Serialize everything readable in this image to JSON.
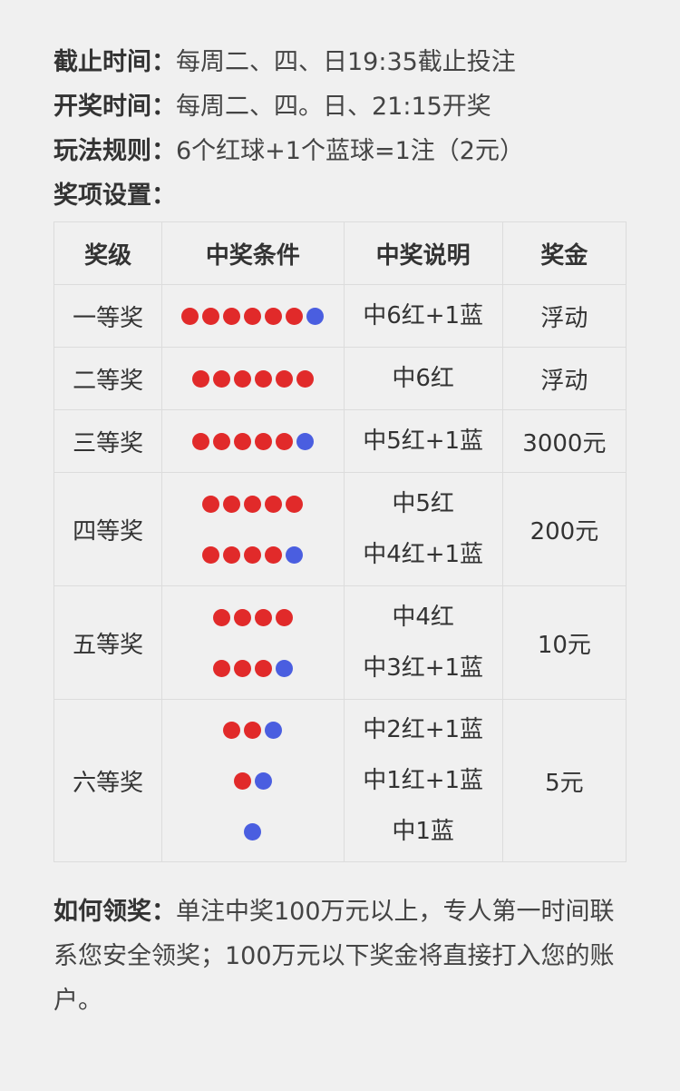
{
  "info": {
    "deadline_label": "截止时间：",
    "deadline_value": "每周二、四、日19:35截止投注",
    "draw_label": "开奖时间：",
    "draw_value": "每周二、四。日、21:15开奖",
    "rules_label": "玩法规则：",
    "rules_value": "6个红球+1个蓝球=1注（2元）",
    "prizes_label": "奖项设置："
  },
  "table": {
    "headers": [
      "奖级",
      "中奖条件",
      "中奖说明",
      "奖金"
    ],
    "rows": [
      {
        "level": "一等奖",
        "conditions": [
          {
            "red": 6,
            "blue": 1
          }
        ],
        "desc": [
          "中6红+1蓝"
        ],
        "prize": "浮动"
      },
      {
        "level": "二等奖",
        "conditions": [
          {
            "red": 6,
            "blue": 0
          }
        ],
        "desc": [
          "中6红"
        ],
        "prize": "浮动"
      },
      {
        "level": "三等奖",
        "conditions": [
          {
            "red": 5,
            "blue": 1
          }
        ],
        "desc": [
          "中5红+1蓝"
        ],
        "prize": "3000元"
      },
      {
        "level": "四等奖",
        "conditions": [
          {
            "red": 5,
            "blue": 0
          },
          {
            "red": 4,
            "blue": 1
          }
        ],
        "desc": [
          "中5红",
          "中4红+1蓝"
        ],
        "prize": "200元"
      },
      {
        "level": "五等奖",
        "conditions": [
          {
            "red": 4,
            "blue": 0
          },
          {
            "red": 3,
            "blue": 1
          }
        ],
        "desc": [
          "中4红",
          "中3红+1蓝"
        ],
        "prize": "10元"
      },
      {
        "level": "六等奖",
        "conditions": [
          {
            "red": 2,
            "blue": 1
          },
          {
            "red": 1,
            "blue": 1
          },
          {
            "red": 0,
            "blue": 1
          }
        ],
        "desc": [
          "中2红+1蓝",
          "中1红+1蓝",
          "中1蓝"
        ],
        "prize": "5元"
      }
    ]
  },
  "claim": {
    "label": "如何领奖：",
    "text": "单注中奖100万元以上，专人第一时间联系您安全领奖；100万元以下奖金将直接打入您的账户。"
  },
  "colors": {
    "red_ball": "#e12a2a",
    "blue_ball": "#4a5ee0"
  }
}
